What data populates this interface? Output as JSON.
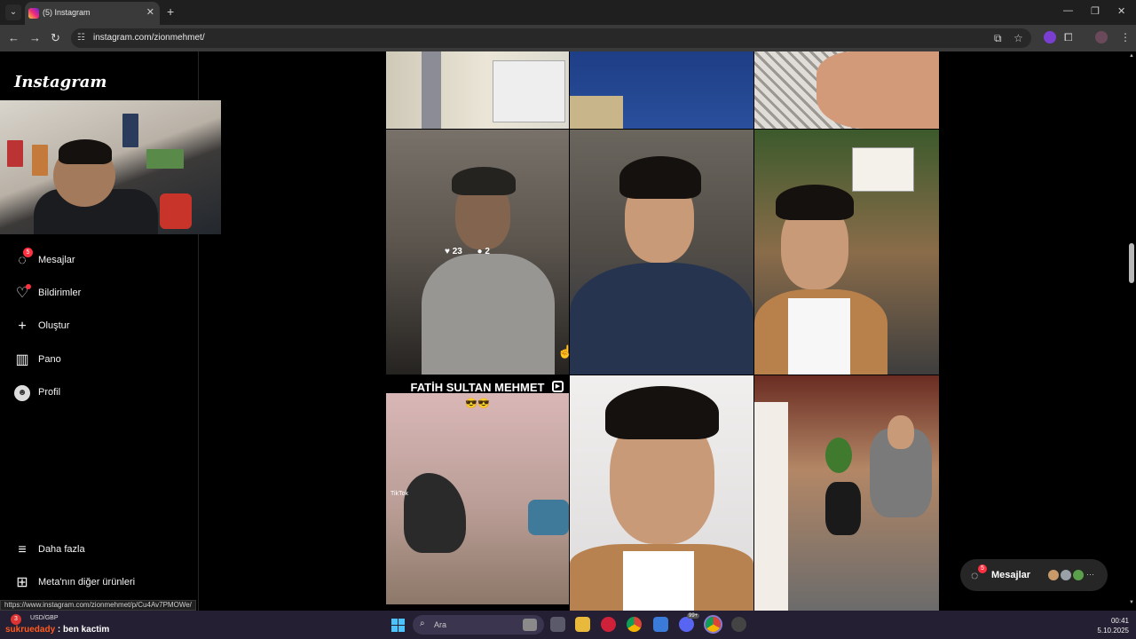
{
  "browser": {
    "tab_title": "(5) Instagram",
    "url": "instagram.com/zionmehmet/",
    "status_url": "https://www.instagram.com/zionmehmet/p/Cu4Av7PMOWe/"
  },
  "instagram": {
    "logo": "Instagram",
    "nav": [
      {
        "label": "Mesajlar",
        "icon": "messenger-icon",
        "badge": "5"
      },
      {
        "label": "Bildirimler",
        "icon": "heart-icon"
      },
      {
        "label": "Oluştur",
        "icon": "plus-icon"
      },
      {
        "label": "Pano",
        "icon": "dashboard-icon"
      },
      {
        "label": "Profil",
        "icon": "profile-avatar-icon"
      }
    ],
    "bottom_nav": [
      {
        "label": "Daha fazla",
        "icon": "menu-icon"
      },
      {
        "label": "Meta'nın diğer ürünleri",
        "icon": "meta-apps-icon"
      }
    ],
    "hover_post": {
      "likes": "23",
      "comments": "2"
    },
    "reel": {
      "title": "FATİH SULTAN MEHMET",
      "emoji": "😎😎",
      "watermark": "TikTok"
    },
    "messages_pill": {
      "label": "Mesajlar",
      "badge": "5"
    }
  },
  "taskbar": {
    "ticker": "USD/GBP",
    "ticker_badge": "3",
    "chat_user": "sukruedady",
    "chat_text": ": ben kactim",
    "search_placeholder": "Ara",
    "discord_badge": "99+",
    "time": "00:41",
    "date": "5.10.2025"
  },
  "colors": {
    "accent_red": "#ff3040",
    "background": "#000000",
    "taskbar": "#241f33"
  }
}
